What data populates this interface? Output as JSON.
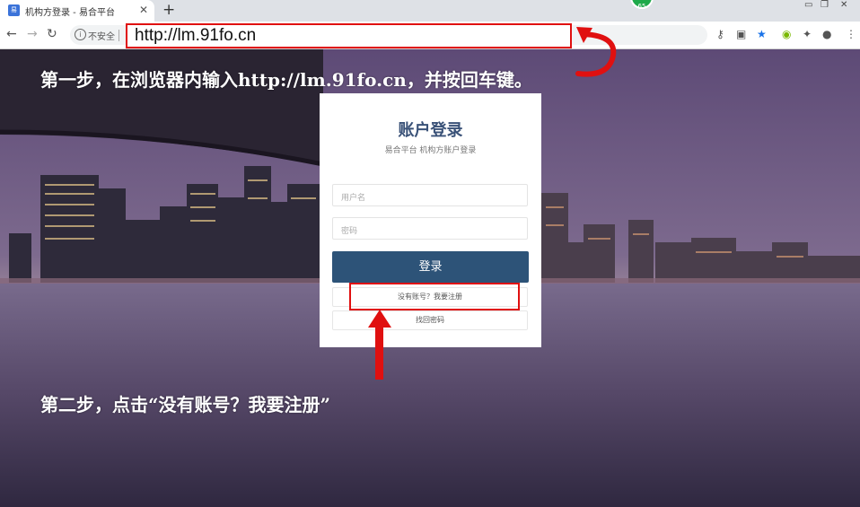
{
  "browser": {
    "tab_title": "机构方登录 - 易合平台",
    "tab_favicon": "易合",
    "new_tab_symbol": "+",
    "extension_badge": "65",
    "security_label": "不安全",
    "url": "http://lm.91fo.cn"
  },
  "annotations": {
    "step1": "第一步，在浏览器内输入http://lm.91fo.cn，并按回车键。",
    "step2": "第二步，点击“没有账号？我要注册”",
    "highlight_color": "#e01010"
  },
  "login": {
    "title": "账户登录",
    "subtitle": "易合平台 机构方账户登录",
    "username_placeholder": "用户名",
    "password_placeholder": "密码",
    "login_button": "登录",
    "register_link": "没有账号？我要注册",
    "forgot_link": "找回密码"
  },
  "colors": {
    "primary_button": "#2d5378",
    "title": "#3a5278"
  }
}
